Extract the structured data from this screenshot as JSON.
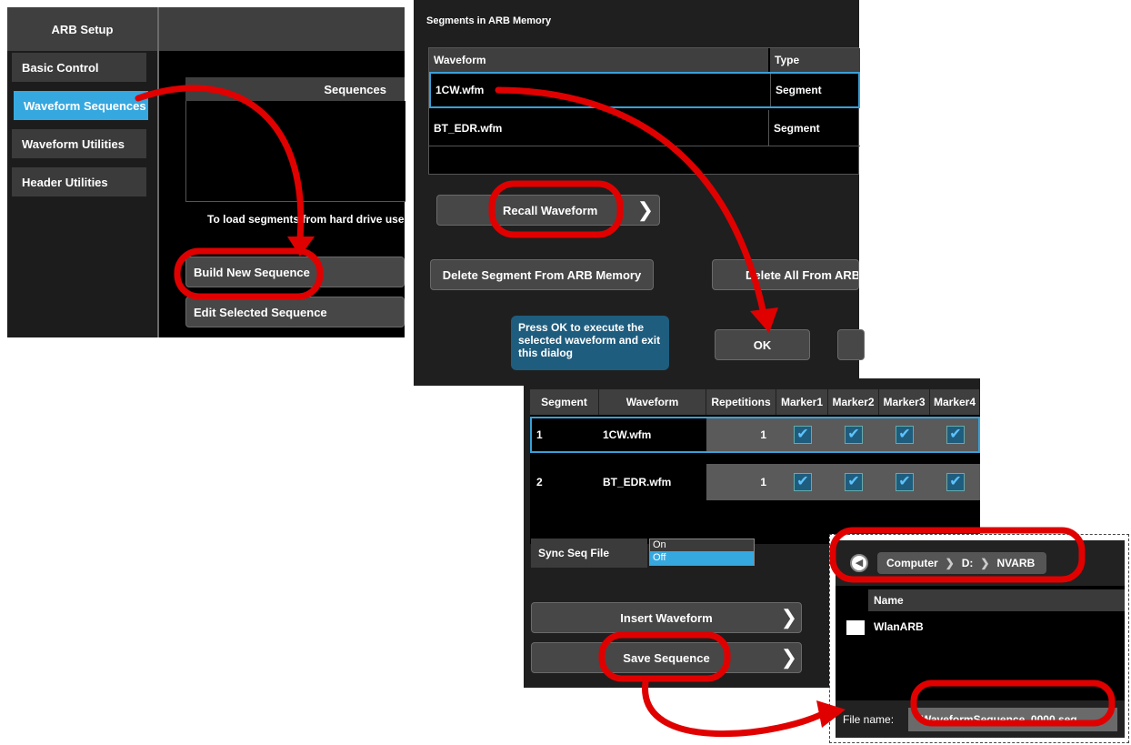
{
  "arb_setup": {
    "header": "ARB Setup",
    "nav": [
      {
        "label": "Basic Control"
      },
      {
        "label": "Waveform Sequences"
      },
      {
        "label": "Waveform Utilities"
      },
      {
        "label": "Header Utilities"
      }
    ],
    "sequences_header": "Sequences",
    "hint": "To load segments from hard drive use",
    "build_button": "Build New Sequence",
    "edit_button": "Edit Selected Sequence"
  },
  "segments_dialog": {
    "title": "Segments in ARB Memory",
    "columns": [
      "Waveform",
      "Type"
    ],
    "rows": [
      {
        "waveform": "1CW.wfm",
        "type": "Segment"
      },
      {
        "waveform": "BT_EDR.wfm",
        "type": "Segment"
      }
    ],
    "recall_button": "Recall Waveform",
    "delete_segment_button": "Delete Segment From ARB Memory",
    "delete_all_button": "Delete All From ARB",
    "tip": "Press OK to execute the selected waveform and exit this dialog",
    "ok_button": "OK"
  },
  "sequence_editor": {
    "columns": [
      "Segment",
      "Waveform",
      "Repetitions",
      "Marker1",
      "Marker2",
      "Marker3",
      "Marker4"
    ],
    "rows": [
      {
        "segment": "1",
        "waveform": "1CW.wfm",
        "repetitions": "1"
      },
      {
        "segment": "2",
        "waveform": "BT_EDR.wfm",
        "repetitions": "1"
      }
    ],
    "sync_label": "Sync Seq File",
    "sync_options": [
      "On",
      "Off"
    ],
    "sync_selected": "Off",
    "insert_button": "Insert Waveform",
    "save_button": "Save Sequence"
  },
  "file_dialog": {
    "breadcrumb": [
      "Computer",
      "D:",
      "NVARB"
    ],
    "name_header": "Name",
    "items": [
      {
        "name": "WlanARB",
        "icon": "folder-icon"
      }
    ],
    "file_name_label": "File name:",
    "file_name_value": "WaveformSequence_0000.seq"
  },
  "colors": {
    "accent": "#35a8e0",
    "annotation": "#e00000",
    "tooltip": "#1f5d7e"
  }
}
